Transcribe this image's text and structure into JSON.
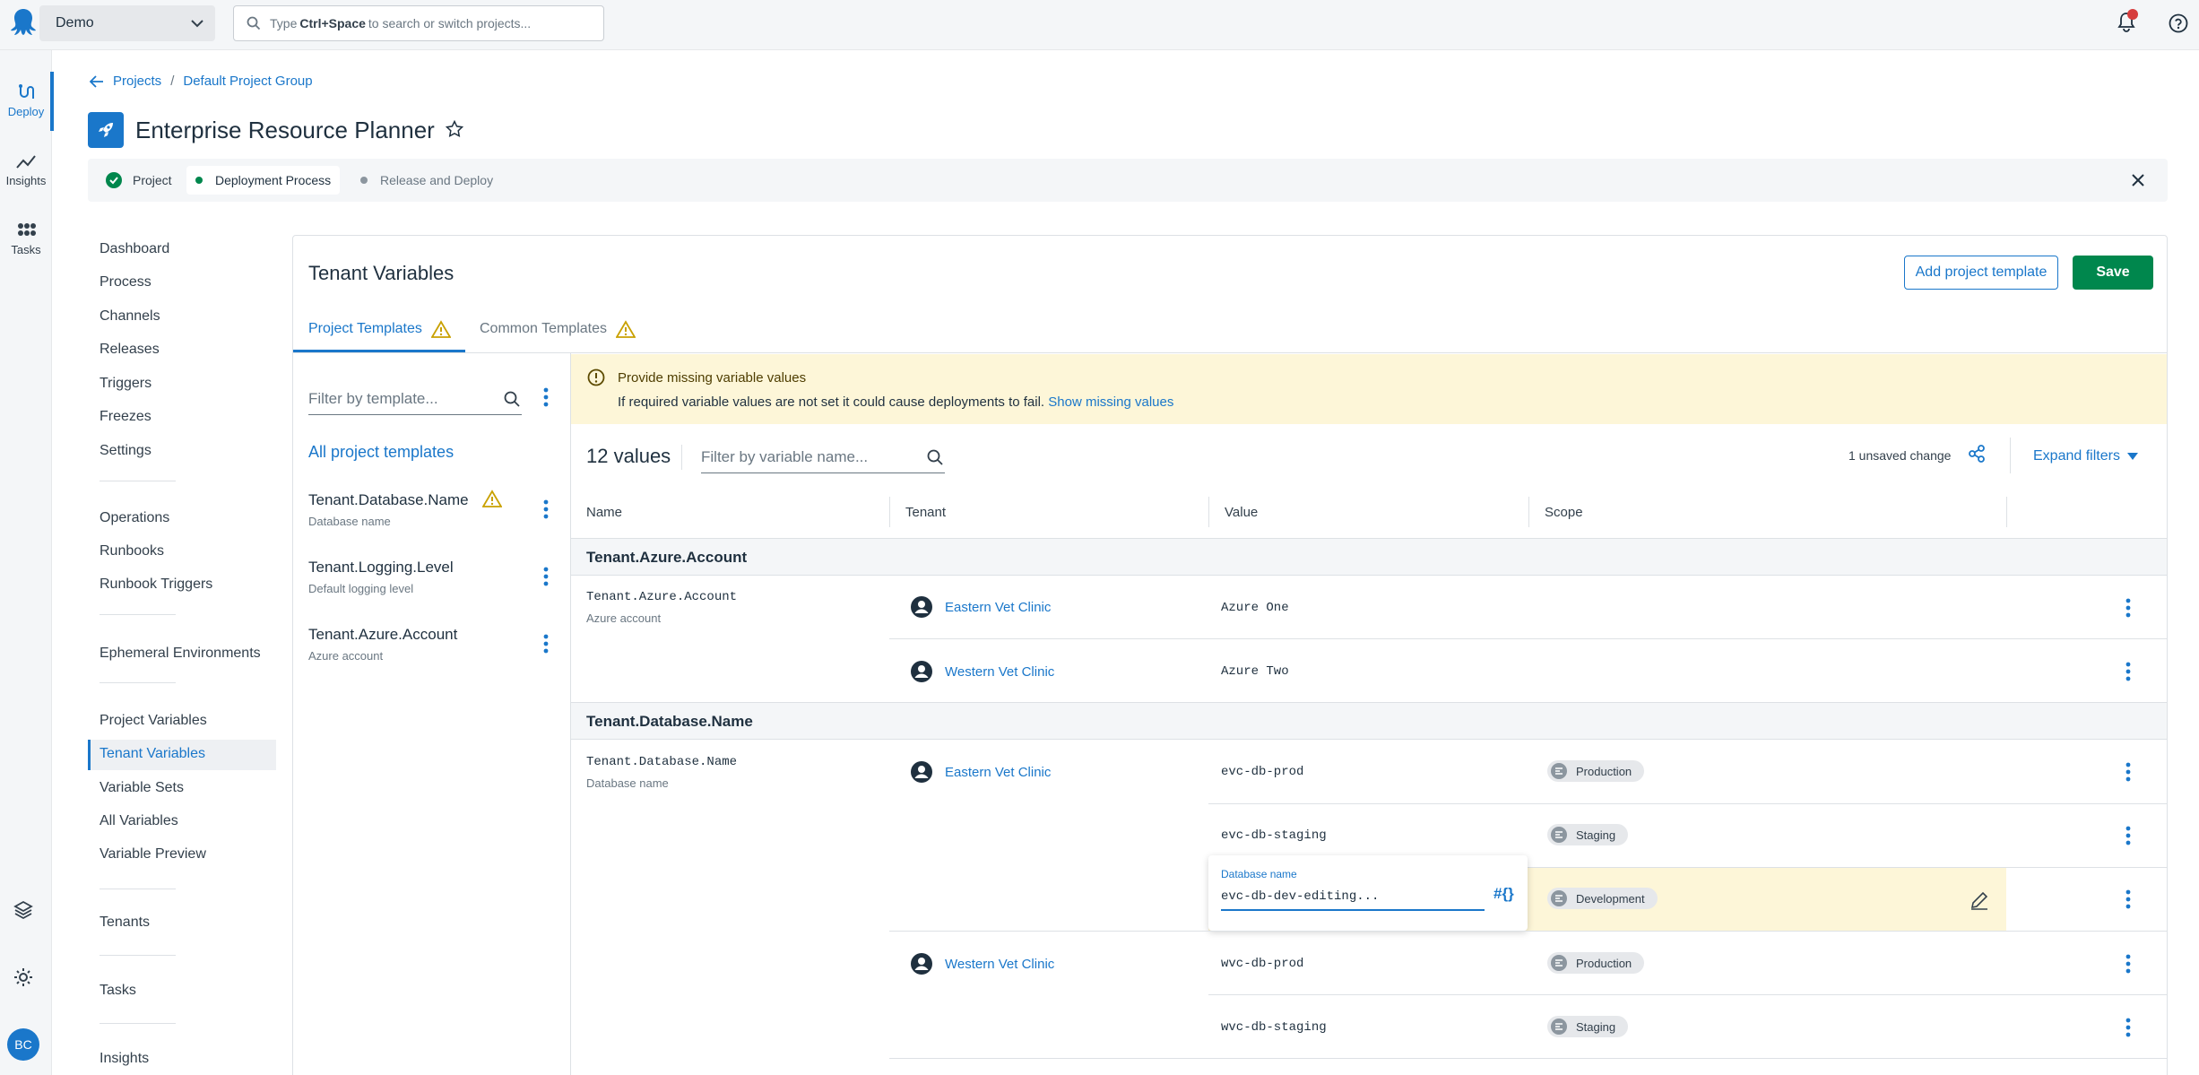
{
  "topbar": {
    "space": "Demo",
    "search_prefix": "Type",
    "search_shortcut": "Ctrl+Space",
    "search_suffix": "to search or switch projects..."
  },
  "rail": {
    "deploy": "Deploy",
    "insights": "Insights",
    "tasks": "Tasks",
    "avatar": "BC"
  },
  "breadcrumb": {
    "projects": "Projects",
    "separator": "/",
    "group": "Default Project Group"
  },
  "project": {
    "title": "Enterprise Resource Planner"
  },
  "stepper": {
    "steps": [
      "Project",
      "Deployment Process",
      "Release and Deploy"
    ]
  },
  "sidenav": {
    "items": [
      "Dashboard",
      "Process",
      "Channels",
      "Releases",
      "Triggers",
      "Freezes",
      "Settings"
    ],
    "ops": [
      "Operations",
      "Runbooks",
      "Runbook Triggers"
    ],
    "ephemeral": "Ephemeral Environments",
    "vars": [
      "Project Variables",
      "Tenant Variables",
      "Variable Sets",
      "All Variables",
      "Variable Preview"
    ],
    "tenants": "Tenants",
    "tasks": "Tasks",
    "insights": "Insights"
  },
  "panel": {
    "title": "Tenant Variables",
    "add_template": "Add project template",
    "save": "Save",
    "tabs": [
      "Project Templates",
      "Common Templates"
    ]
  },
  "templates": {
    "filter_placeholder": "Filter by template...",
    "all_label": "All project templates",
    "items": [
      {
        "name": "Tenant.Database.Name",
        "sub": "Database name"
      },
      {
        "name": "Tenant.Logging.Level",
        "sub": "Default logging level"
      },
      {
        "name": "Tenant.Azure.Account",
        "sub": "Azure account"
      }
    ]
  },
  "warning": {
    "title": "Provide missing variable values",
    "body": "If required variable values are not set it could cause deployments to fail.",
    "link": "Show missing values"
  },
  "values": {
    "count": "12 values",
    "filter_placeholder": "Filter by variable name...",
    "unsaved": "1 unsaved change",
    "expand_filters": "Expand filters",
    "columns": [
      "Name",
      "Tenant",
      "Value",
      "Scope"
    ]
  },
  "groups": [
    {
      "title": "Tenant.Azure.Account",
      "name": "Tenant.Azure.Account",
      "sub": "Azure account",
      "rows": [
        {
          "tenant": "Eastern Vet Clinic",
          "value": "Azure One",
          "scope": ""
        },
        {
          "tenant": "Western Vet Clinic",
          "value": "Azure Two",
          "scope": ""
        }
      ]
    },
    {
      "title": "Tenant.Database.Name",
      "name": "Tenant.Database.Name",
      "sub": "Database name",
      "rows": [
        {
          "tenant": "Eastern Vet Clinic",
          "value": "evc-db-prod",
          "scope": "Production"
        },
        {
          "tenant": "",
          "value": "evc-db-staging",
          "scope": "Staging"
        },
        {
          "tenant": "",
          "value": "evc-db-dev-editing...",
          "scope": "Development"
        },
        {
          "tenant": "Western Vet Clinic",
          "value": "wvc-db-prod",
          "scope": "Production"
        },
        {
          "tenant": "",
          "value": "wvc-db-staging",
          "scope": "Staging"
        }
      ]
    }
  ],
  "editor": {
    "label": "Database name",
    "value": "evc-db-dev-editing...",
    "hash": "#{}"
  },
  "colors": {
    "accent": "#1a77ca",
    "save": "#00874d",
    "warning_bg": "#fdf6d8",
    "success": "#00874d"
  }
}
